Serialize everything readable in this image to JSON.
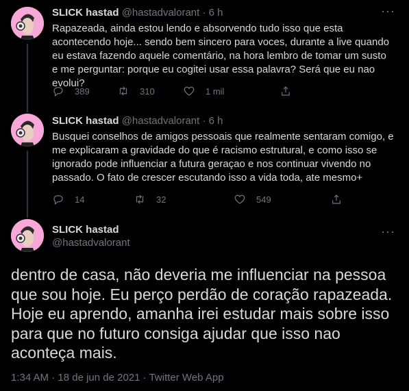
{
  "tweets": [
    {
      "name": "SLICK hastad",
      "handle": "@hastadvalorant",
      "time": "6 h",
      "text": "Rapazeada, ainda estou lendo e absorvendo tudo isso que esta acontecendo hoje... sendo bem sincero para voces, durante a live quando eu estava fazendo aquele comentário, na hora lembro de tomar um susto e me perguntar: porque eu cogitei usar essa palavra? Será que eu nao evolui?",
      "replies": "389",
      "retweets": "310",
      "likes": "1 mil"
    },
    {
      "name": "SLICK hastad",
      "handle": "@hastadvalorant",
      "time": "6 h",
      "text": "Busquei conselhos de amigos pessoais que realmente sentaram comigo, e me explicaram a gravidade do que é racismo estrutural, e como isso se ignorado pode influenciar a futura geraçao e nos continuar vivendo no passado. O fato de crescer escutando isso a vida toda, ate mesmo+",
      "replies": "14",
      "retweets": "32",
      "likes": "549"
    }
  ],
  "main": {
    "name": "SLICK hastad",
    "handle": "@hastadvalorant",
    "text": "dentro de casa, não deveria me influenciar na pessoa que sou hoje. Eu perço perdão de coração rapazeada. Hoje eu aprendo, amanha irei estudar mais sobre isso para que no futuro consiga ajudar que isso nao aconteça mais.",
    "time": "1:34 AM",
    "date": "18 de jun de 2021",
    "source": "Twitter Web App"
  },
  "separator": "·",
  "more_label": "···"
}
